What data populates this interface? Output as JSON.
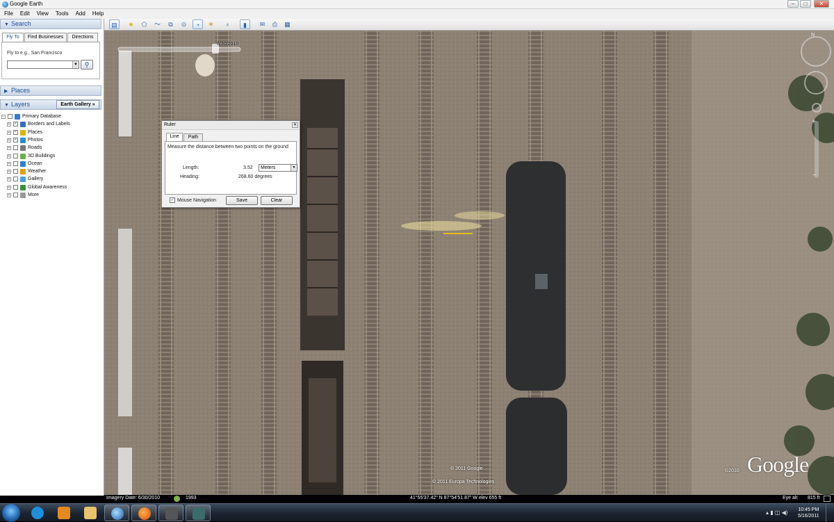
{
  "window": {
    "title": "Google Earth"
  },
  "menu": [
    "File",
    "Edit",
    "View",
    "Tools",
    "Add",
    "Help"
  ],
  "search": {
    "header": "Search",
    "tabs": [
      "Fly To",
      "Find Businesses",
      "Directions"
    ],
    "fly_to_hint": "Fly to e.g., San Francisco",
    "input_value": ""
  },
  "places": {
    "header": "Places"
  },
  "layers": {
    "header": "Layers",
    "gallery_button": "Earth Gallery »",
    "items": [
      {
        "label": "Primary Database",
        "checked": false
      },
      {
        "label": "Borders and Labels",
        "checked": true
      },
      {
        "label": "Places",
        "checked": true
      },
      {
        "label": "Photos",
        "checked": true
      },
      {
        "label": "Roads",
        "checked": false
      },
      {
        "label": "3D Buildings",
        "checked": false
      },
      {
        "label": "Ocean",
        "checked": false
      },
      {
        "label": "Weather",
        "checked": false
      },
      {
        "label": "Gallery",
        "checked": false
      },
      {
        "label": "Global Awareness",
        "checked": false
      },
      {
        "label": "More",
        "checked": false
      }
    ]
  },
  "toolbar": {
    "icons": [
      "sidebar-icon",
      "placemark-icon",
      "polygon-icon",
      "path-icon",
      "overlay-icon",
      "record-tour-icon",
      "historical-imagery-icon",
      "sun-icon",
      "planets-icon",
      "ruler-icon",
      "email-icon",
      "print-icon",
      "view-in-maps-icon"
    ]
  },
  "map": {
    "time_slider_date": "6/30/2010",
    "copyright_1": "© 2011 Google",
    "copyright_2": "© 2011 Europa Technologies",
    "logo_year": "©2010",
    "logo": "Google"
  },
  "ruler": {
    "title": "Ruler",
    "tabs": [
      "Line",
      "Path"
    ],
    "instruction": "Measure the distance between two points on the ground",
    "length_label": "Length:",
    "length_value": "3.52",
    "unit": "Meters",
    "heading_label": "Heading:",
    "heading_value": "268.60 degrees",
    "mouse_nav_label": "Mouse Navigation",
    "mouse_nav_checked": true,
    "save_label": "Save",
    "clear_label": "Clear"
  },
  "status": {
    "imagery_date": "Imagery Date: 6/30/2010",
    "year": "1993",
    "coords": "41°55'37.42\" N   87°54'51.87\" W  elev   655 ft",
    "eye_alt_label": "Eye alt",
    "eye_alt_value": "815 ft"
  },
  "taskbar": {
    "items": [
      "start-orb",
      "internet-explorer-icon",
      "media-player-icon",
      "file-explorer-icon",
      "google-earth-icon",
      "firefox-icon",
      "camera-app-icon",
      "game-app-icon"
    ],
    "time": "10:45 PM",
    "date": "5/16/2011"
  },
  "colors": {
    "accent": "#1f4f96",
    "ruler_line": "#ffd400"
  }
}
